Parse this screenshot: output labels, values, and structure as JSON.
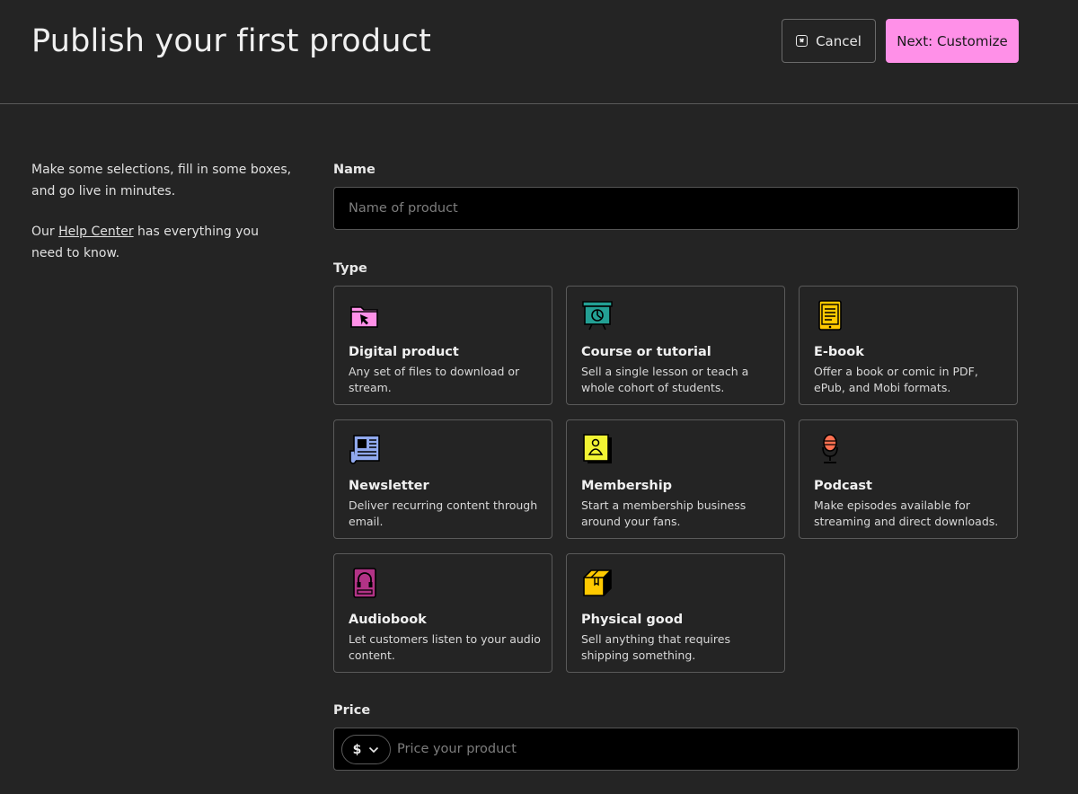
{
  "header": {
    "title": "Publish your first product",
    "cancel_label": "Cancel",
    "next_label": "Next: Customize"
  },
  "intro": {
    "line1": "Make some selections, fill in some boxes, and go live in minutes.",
    "prefix": "Our ",
    "help_link": "Help Center",
    "suffix": " has everything you need to know."
  },
  "name_field": {
    "label": "Name",
    "placeholder": "Name of product",
    "value": ""
  },
  "type_section": {
    "label": "Type",
    "cards": [
      {
        "title": "Digital product",
        "description": "Any set of files to download or stream.",
        "icon": "folder-cursor-icon",
        "color": "#ff90e8"
      },
      {
        "title": "Course or tutorial",
        "description": "Sell a single lesson or teach a whole cohort of students.",
        "icon": "presentation-board-icon",
        "color": "#23a094"
      },
      {
        "title": "E-book",
        "description": "Offer a book or comic in PDF, ePub, and Mobi formats.",
        "icon": "ebook-reader-icon",
        "color": "#ffc900"
      },
      {
        "title": "Newsletter",
        "description": "Deliver recurring content through email.",
        "icon": "newspaper-icon",
        "color": "#90a8ed"
      },
      {
        "title": "Membership",
        "description": "Start a membership business around your fans.",
        "icon": "membership-card-icon",
        "color": "#f1f333"
      },
      {
        "title": "Podcast",
        "description": "Make episodes available for streaming and direct downloads.",
        "icon": "microphone-icon",
        "color": "#ff7051"
      },
      {
        "title": "Audiobook",
        "description": "Let customers listen to your audio content.",
        "icon": "audiobook-player-icon",
        "color": "#b23386"
      },
      {
        "title": "Physical good",
        "description": "Sell anything that requires shipping something.",
        "icon": "package-box-icon",
        "color": "#ffc900"
      }
    ]
  },
  "price_field": {
    "label": "Price",
    "currency": "$",
    "placeholder": "Price your product",
    "value": ""
  }
}
